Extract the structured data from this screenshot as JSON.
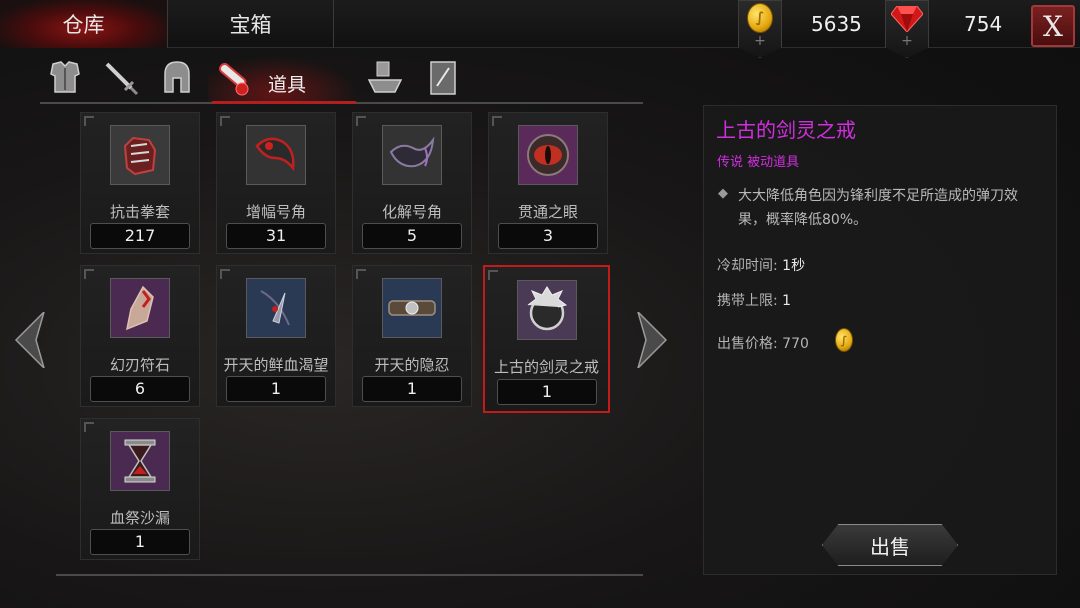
{
  "top_tabs": [
    {
      "label": "仓库",
      "active": true
    },
    {
      "label": "宝箱",
      "active": false
    }
  ],
  "currency": {
    "gold": "5635",
    "gems": "754",
    "add_symbol": "+",
    "coin_glyph": "∫"
  },
  "close_label": "X",
  "categories": [
    {
      "icon": "armor-icon"
    },
    {
      "icon": "sword-icon"
    },
    {
      "icon": "helmet-icon"
    },
    {
      "icon": "potion-icon",
      "label": "道具",
      "active": true
    },
    {
      "icon": "anvil-icon"
    },
    {
      "icon": "scroll-icon"
    }
  ],
  "items": [
    {
      "name": "抗击拳套",
      "count": "217",
      "icon": "gauntlet-icon",
      "bg": "#3a3a3a"
    },
    {
      "name": "增幅号角",
      "count": "31",
      "icon": "horn-icon",
      "bg": "#333333"
    },
    {
      "name": "化解号角",
      "count": "5",
      "icon": "horn-dark-icon",
      "bg": "#333333"
    },
    {
      "name": "贯通之眼",
      "count": "3",
      "icon": "eye-icon",
      "bg": "#5a2a5a"
    },
    {
      "name": "幻刃符石",
      "count": "6",
      "icon": "rune-stone-icon",
      "bg": "#4a2a50"
    },
    {
      "name": "开天的鲜血渴望",
      "count": "1",
      "icon": "blood-blade-icon",
      "bg": "#2a3a55"
    },
    {
      "name": "开天的隐忍",
      "count": "1",
      "icon": "belt-icon",
      "bg": "#2a3a55"
    },
    {
      "name": "上古的剑灵之戒",
      "count": "1",
      "icon": "spiked-ring-icon",
      "bg": "#4a3a55",
      "selected": true
    },
    {
      "name": "血祭沙漏",
      "count": "1",
      "icon": "hourglass-icon",
      "bg": "#4a2a50"
    }
  ],
  "detail": {
    "title": "上古的剑灵之戒",
    "subtitle": "传说 被动道具",
    "bullet": "◆",
    "description": "大大降低角色因为锋利度不足所造成的弹刀效果，概率降低80%。",
    "cooldown_label": "冷却时间:",
    "cooldown_value": "1秒",
    "carry_label": "携带上限:",
    "carry_value": "1",
    "price_label": "出售价格:",
    "price_value": "770",
    "sell_label": "出售"
  },
  "colors": {
    "legendary": "#d12ee0",
    "selected_border": "#c41a1a",
    "tab_active": "#8a1414"
  }
}
